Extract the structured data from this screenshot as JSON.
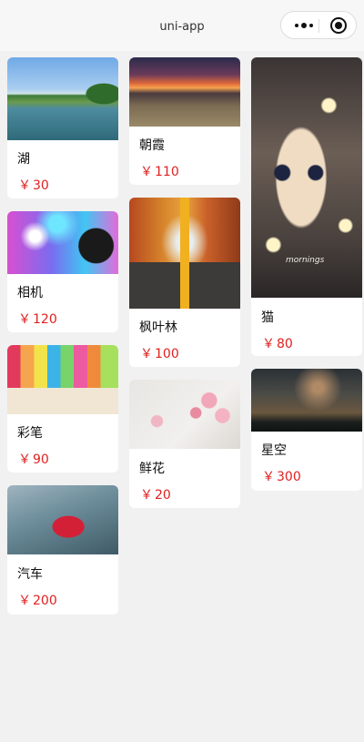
{
  "navbar": {
    "title": "uni-app"
  },
  "currency_symbol": "￥",
  "items": [
    {
      "name": "湖",
      "price": "30",
      "image": "lake"
    },
    {
      "name": "相机",
      "price": "120",
      "image": "camera"
    },
    {
      "name": "彩笔",
      "price": "90",
      "image": "pencils"
    },
    {
      "name": "汽车",
      "price": "200",
      "image": "car"
    },
    {
      "name": "朝霞",
      "price": "110",
      "image": "dawn"
    },
    {
      "name": "枫叶林",
      "price": "100",
      "image": "maple-forest"
    },
    {
      "name": "鲜花",
      "price": "20",
      "image": "flowers"
    },
    {
      "name": "猫",
      "price": "80",
      "image": "cat",
      "image_text": "mornings"
    },
    {
      "name": "星空",
      "price": "300",
      "image": "starry-sky"
    }
  ],
  "colors": {
    "price": "#e02020",
    "background": "#f1f1f1",
    "card": "#ffffff"
  }
}
